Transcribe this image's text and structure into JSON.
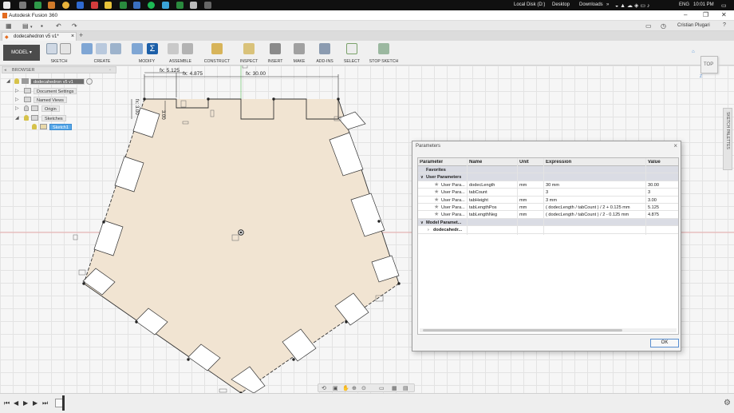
{
  "taskbar": {
    "drive": "Local Disk (D:)",
    "desktop": "Desktop",
    "downloads": "Downloads",
    "chevron": "»",
    "lang": "ENG",
    "time": "10:01 PM"
  },
  "window": {
    "title": "Autodesk Fusion 360",
    "minimize": "–",
    "maximize": "❐",
    "close": "✕"
  },
  "quickbar": {
    "grid": "▦",
    "file": "▤",
    "undo": "↶",
    "redo": "↷",
    "user": "Cristian Plugari",
    "help": "?"
  },
  "document_tab": {
    "name": "dodecahedron v5 v1*",
    "close": "×",
    "add": "+"
  },
  "toolbar": {
    "model": "MODEL",
    "groups": [
      "SKETCH",
      "CREATE",
      "MODIFY",
      "ASSEMBLE",
      "CONSTRUCT",
      "INSPECT",
      "INSERT",
      "MAKE",
      "ADD-INS",
      "SELECT",
      "STOP SKETCH"
    ]
  },
  "browser": {
    "title": "BROWSER",
    "root": "dodecahedron v5 v1",
    "items": [
      "Document Settings",
      "Named Views",
      "Origin",
      "Sketches",
      "Sketch1"
    ]
  },
  "viewcube": {
    "label": "TOP"
  },
  "side_tab": "SKETCH PALETTES",
  "dimensions": {
    "d1": "fx: 5.125",
    "d2": "fx: 4.875",
    "d3": "fx: 30.00",
    "d4": "fx: 3.00",
    "d5": "3.00"
  },
  "parameters_dialog": {
    "title": "Parameters",
    "close": "×",
    "columns": [
      "Parameter",
      "Name",
      "Unit",
      "Expression",
      "Value"
    ],
    "favorites": "Favorites",
    "user_group": "User Parameters",
    "user_rows": [
      {
        "param": "User Para...",
        "name": "dodecLength",
        "unit": "mm",
        "expr": "30 mm",
        "value": "30.00"
      },
      {
        "param": "User Para...",
        "name": "tabCount",
        "unit": "",
        "expr": "3",
        "value": "3"
      },
      {
        "param": "User Para...",
        "name": "tabHeight",
        "unit": "mm",
        "expr": "3 mm",
        "value": "3.00"
      },
      {
        "param": "User Para...",
        "name": "tabLengthPos",
        "unit": "mm",
        "expr": "( dodecLength / tabCount ) / 2 + 0.125 mm",
        "value": "5.125"
      },
      {
        "param": "User Para...",
        "name": "tabLengthNeg",
        "unit": "mm",
        "expr": "( dodecLength / tabCount ) / 2 - 0.125 mm",
        "value": "4.875"
      }
    ],
    "model_group": "Model Paramet...",
    "model_item": "dodecahedr...",
    "ok": "OK"
  },
  "colors": {
    "sketch_fill": "#f1e4d2",
    "axis_green": "#7ccb7c",
    "axis_red": "#e89898",
    "accent_blue": "#0696d7",
    "selected_blue": "#58a8e8"
  }
}
